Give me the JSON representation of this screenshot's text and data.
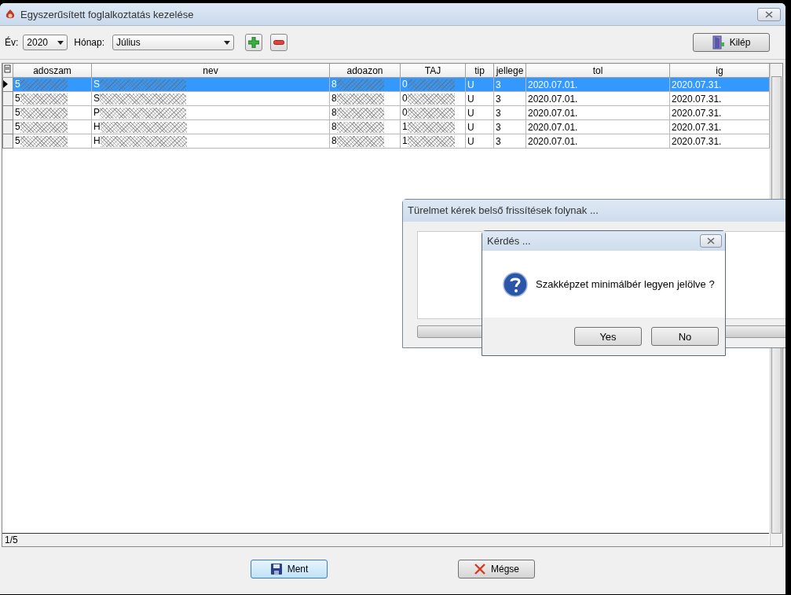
{
  "window": {
    "title": "Egyszerűsített foglalkoztatás kezelése"
  },
  "toolbar": {
    "year_label": "Év:",
    "year": "2020",
    "month_label": "Hónap:",
    "month": "Július",
    "exit_button": "Kilép"
  },
  "table": {
    "columns": [
      "adoszam",
      "nev",
      "adoazon",
      "TAJ",
      "tip",
      "jellege",
      "tol",
      "ig"
    ],
    "rows": [
      {
        "selected": true,
        "cells": [
          "5",
          "S",
          "8",
          "0",
          "U",
          "3",
          "2020.07.01.",
          "2020.07.31."
        ]
      },
      {
        "selected": false,
        "cells": [
          "5",
          "S",
          "8",
          "0",
          "U",
          "3",
          "2020.07.01.",
          "2020.07.31."
        ]
      },
      {
        "selected": false,
        "cells": [
          "5",
          "P",
          "8",
          "0",
          "U",
          "3",
          "2020.07.01.",
          "2020.07.31."
        ]
      },
      {
        "selected": false,
        "cells": [
          "5",
          "H",
          "8",
          "1",
          "U",
          "3",
          "2020.07.01.",
          "2020.07.31."
        ]
      },
      {
        "selected": false,
        "cells": [
          "5",
          "H",
          "8",
          "1",
          "U",
          "3",
          "2020.07.01.",
          "2020.07.31."
        ]
      }
    ]
  },
  "status_bar": "1/5",
  "buttons": [
    {
      "kind": "save",
      "label": "Ment"
    },
    {
      "kind": "cancel",
      "label": "Mégse"
    }
  ],
  "progress_dialog": {
    "title": "Türelmet kérek belső frissítések folynak ...",
    "level": 0
  },
  "question_dialog": {
    "title": "Kérdés ...",
    "message": "Szakképzet minimálbér legyen jelölve ?",
    "buttons": [
      "Yes",
      "No"
    ]
  }
}
